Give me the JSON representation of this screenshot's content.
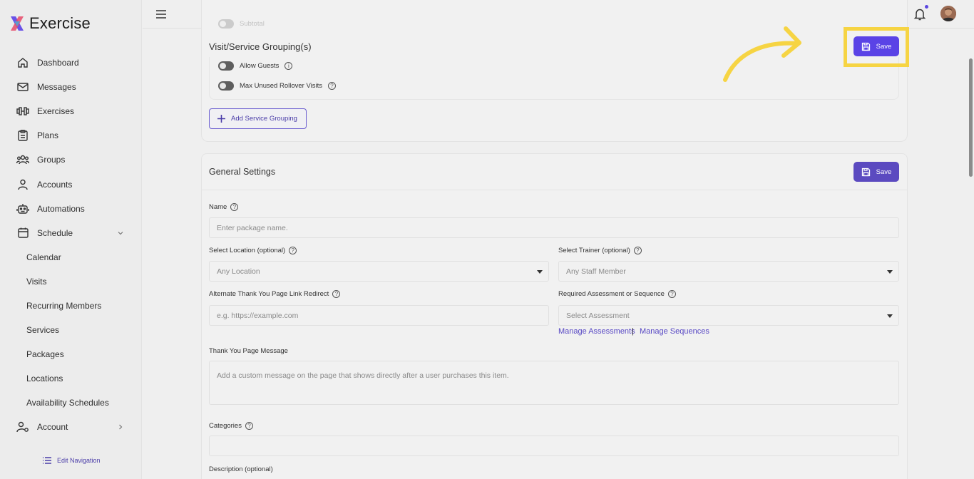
{
  "brand": {
    "name": "Exercise"
  },
  "sidebar": {
    "items": [
      {
        "label": "Dashboard",
        "icon": "home-icon"
      },
      {
        "label": "Messages",
        "icon": "mail-icon"
      },
      {
        "label": "Exercises",
        "icon": "dumbbell-icon"
      },
      {
        "label": "Plans",
        "icon": "clipboard-icon"
      },
      {
        "label": "Groups",
        "icon": "users-icon"
      },
      {
        "label": "Accounts",
        "icon": "user-icon"
      },
      {
        "label": "Automations",
        "icon": "robot-icon"
      },
      {
        "label": "Schedule",
        "icon": "calendar-icon"
      },
      {
        "label": "Calendar"
      },
      {
        "label": "Visits"
      },
      {
        "label": "Recurring Members"
      },
      {
        "label": "Services"
      },
      {
        "label": "Packages"
      },
      {
        "label": "Locations"
      },
      {
        "label": "Availability Schedules"
      },
      {
        "label": "Account",
        "icon": "user-gear-icon"
      }
    ],
    "edit_navigation": "Edit Navigation"
  },
  "grouping": {
    "hidden_top_label": "Subtotal",
    "title": "Visit/Service Grouping(s)",
    "allow_guests": "Allow Guests",
    "max_rollover": "Max Unused Rollover Visits",
    "add_button": "Add Service Grouping"
  },
  "save_label": "Save",
  "general": {
    "title": "General Settings",
    "name_label": "Name",
    "name_placeholder": "Enter package name.",
    "location_label": "Select Location (optional)",
    "location_value": "Any Location",
    "trainer_label": "Select Trainer (optional)",
    "trainer_value": "Any Staff Member",
    "redirect_label": "Alternate Thank You Page Link Redirect",
    "redirect_placeholder": "e.g. https://example.com",
    "assessment_label": "Required Assessment or Sequence",
    "assessment_value": "Select Assessment",
    "manage_assessments": "Manage Assessments",
    "separator": "|",
    "manage_sequences": "Manage Sequences",
    "thank_you_label": "Thank You Page Message",
    "thank_you_placeholder": "Add a custom message on the page that shows directly after a user purchases this item.",
    "categories_label": "Categories",
    "description_label": "Description (optional)"
  },
  "colors": {
    "accent": "#5a43e6",
    "highlight": "#f6d443",
    "link": "#5747c4"
  }
}
